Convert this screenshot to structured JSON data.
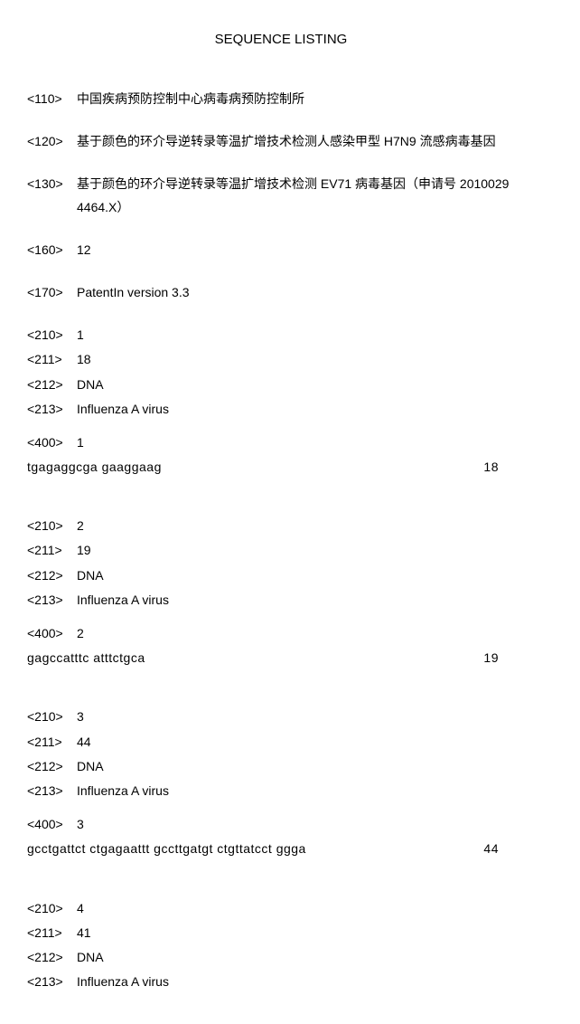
{
  "header": "SEQUENCE LISTING",
  "meta": {
    "e110": {
      "tag": "<110>",
      "value": "中国疾病预防控制中心病毒病预防控制所"
    },
    "e120": {
      "tag": "<120>",
      "value": "基于颜色的环介导逆转录等温扩增技术检测人感染甲型 H7N9 流感病毒基因"
    },
    "e130": {
      "tag": "<130>",
      "value": "基于颜色的环介导逆转录等温扩增技术检测 EV71 病毒基因（申请号 2010029 4464.X）"
    },
    "e160": {
      "tag": "<160>",
      "value": "12"
    },
    "e170": {
      "tag": "<170>",
      "value": "PatentIn version 3.3"
    }
  },
  "sequences": [
    {
      "e210": {
        "tag": "<210>",
        "value": "1"
      },
      "e211": {
        "tag": "<211>",
        "value": "18"
      },
      "e212": {
        "tag": "<212>",
        "value": "DNA"
      },
      "e213": {
        "tag": "<213>",
        "value": "Influenza A virus"
      },
      "e400": {
        "tag": "<400>",
        "value": "1"
      },
      "seq": "tgagaggcga gaaggaag",
      "len": "18"
    },
    {
      "e210": {
        "tag": "<210>",
        "value": "2"
      },
      "e211": {
        "tag": "<211>",
        "value": "19"
      },
      "e212": {
        "tag": "<212>",
        "value": "DNA"
      },
      "e213": {
        "tag": "<213>",
        "value": "Influenza A virus"
      },
      "e400": {
        "tag": "<400>",
        "value": "2"
      },
      "seq": "gagccatttc atttctgca",
      "len": "19"
    },
    {
      "e210": {
        "tag": "<210>",
        "value": "3"
      },
      "e211": {
        "tag": "<211>",
        "value": "44"
      },
      "e212": {
        "tag": "<212>",
        "value": "DNA"
      },
      "e213": {
        "tag": "<213>",
        "value": "Influenza A virus"
      },
      "e400": {
        "tag": "<400>",
        "value": "3"
      },
      "seq": "gcctgattct ctgagaattt gccttgatgt ctgttatcct ggga",
      "len": "44"
    },
    {
      "e210": {
        "tag": "<210>",
        "value": "4"
      },
      "e211": {
        "tag": "<211>",
        "value": "41"
      },
      "e212": {
        "tag": "<212>",
        "value": "DNA"
      },
      "e213": {
        "tag": "<213>",
        "value": "Influenza A virus"
      }
    }
  ]
}
